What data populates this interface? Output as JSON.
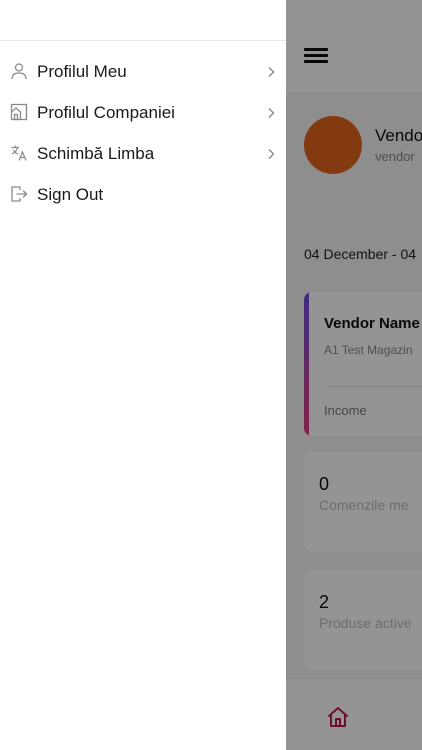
{
  "menu": {
    "items": [
      {
        "label": "Profilul Meu",
        "icon": "user-icon",
        "has_chevron": true
      },
      {
        "label": "Profilul Companiei",
        "icon": "company-icon",
        "has_chevron": true
      },
      {
        "label": "Schimbă Limba",
        "icon": "translate-icon",
        "has_chevron": true
      },
      {
        "label": "Sign Out",
        "icon": "sign-out-icon",
        "has_chevron": false
      }
    ]
  },
  "app": {
    "vendor_title": "Vendor",
    "vendor_subtitle": "vendor",
    "date_range": "04 December - 04",
    "vendor_card": {
      "name": "Vendor Name",
      "company": "A1 Test Magazin",
      "income_label": "Income"
    },
    "stats": [
      {
        "value": "0",
        "label": "Comenzile me"
      },
      {
        "value": "2",
        "label": "Produse active"
      }
    ]
  },
  "colors": {
    "accent": "#c2185b",
    "avatar": "#e4641c",
    "overlay": "rgba(0,0,0,0.42)"
  }
}
